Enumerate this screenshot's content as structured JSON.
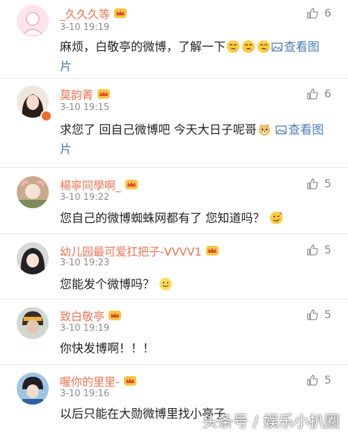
{
  "comments": [
    {
      "name": "_久久久等",
      "time": "3-10 19:19",
      "likes": "6",
      "text": "麻烦，白敬亭的微博，了解一下",
      "link": "查看图片",
      "emojis": [
        "drool-emoji",
        "drool-emoji",
        "drool-emoji"
      ]
    },
    {
      "name": "莫韵菁",
      "time": "3-10 19:15",
      "likes": "6",
      "text": "求您了 回自己微博吧 今天大日子呢哥",
      "link": "查看图片",
      "emojis": [
        "doge-emoji"
      ]
    },
    {
      "name": "楊寧同學啊_",
      "time": "3-10 19:22",
      "likes": "5",
      "text": "您自己的微博蜘蛛网都有了 您知道吗？",
      "emojis": [
        "wink-emoji"
      ]
    },
    {
      "name": "幼儿园最可爱扛把子-VVVV1",
      "time": "3-10 19:23",
      "likes": "5",
      "text": "您能发个微博吗？",
      "emojis": [
        "smile-emoji"
      ]
    },
    {
      "name": "致白敬亭",
      "time": "3-10 19:19",
      "likes": "5",
      "text": "你快发博啊！！！"
    },
    {
      "name": "喔你的里里-",
      "time": "3-10 19:16",
      "likes": "5",
      "text": "以后只能在大勋微博里找小亭子"
    }
  ],
  "watermark": "头条号 / 娱乐小扒圈",
  "colors": {
    "name": "#eb7350",
    "time": "#8c8c8c",
    "link": "#4a7ab5"
  }
}
